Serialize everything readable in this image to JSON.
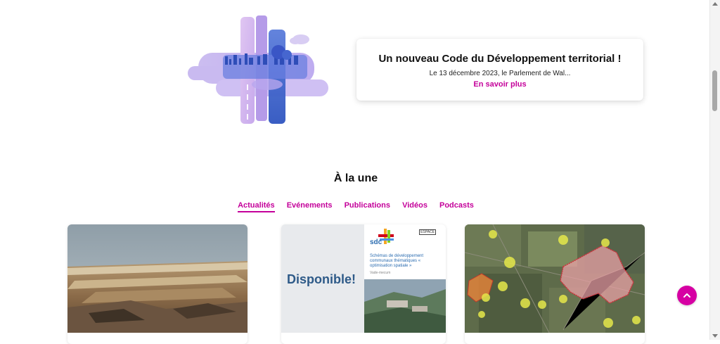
{
  "feature": {
    "title": "Un nouveau Code du Développement territorial !",
    "description": "Le 13 décembre 2023, le Parlement de Wal...",
    "link_label": "En savoir plus"
  },
  "section": {
    "title": "À la une",
    "tabs": [
      {
        "label": "Actualités",
        "active": true
      },
      {
        "label": "Evénements",
        "active": false
      },
      {
        "label": "Publications",
        "active": false
      },
      {
        "label": "Vidéos",
        "active": false
      },
      {
        "label": "Podcasts",
        "active": false
      }
    ]
  },
  "cards": [
    {
      "image": "quarry-landscape-photo"
    },
    {
      "image": "publication-cover",
      "banner_text": "Disponible!",
      "cover_logo": "sdc",
      "cover_tag": "ESPACE",
      "cover_subtitle": "Schémas de développement communaux thématiques « optimisation spatiale »",
      "cover_caption": "Vade-mecum"
    },
    {
      "image": "aerial-map"
    }
  ],
  "colors": {
    "accent": "#c4009a",
    "back_to_top": "#d600a3"
  },
  "icons": {
    "back_to_top": "chevron-up-icon"
  }
}
